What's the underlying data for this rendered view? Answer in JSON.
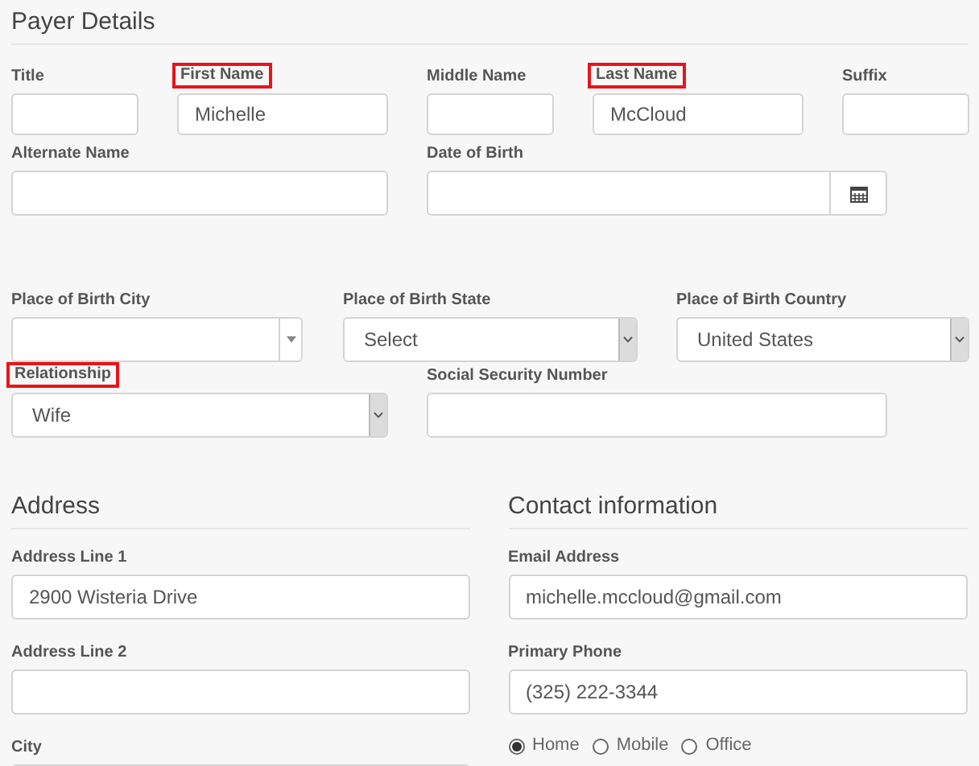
{
  "payer_details": {
    "title": "Payer Details",
    "rows": [
      {
        "fields": [
          {
            "label": "Title",
            "kind": "text",
            "highlighted": false
          },
          {
            "label": "First Name",
            "kind": "text",
            "value": "Michelle",
            "highlighted": true
          },
          {
            "label": "Middle Name",
            "kind": "text",
            "highlighted": false
          },
          {
            "label": "Last Name",
            "kind": "text",
            "value": "McCloud",
            "highlighted": true
          },
          {
            "label": "Suffix",
            "kind": "text",
            "highlighted": false
          }
        ]
      },
      {
        "fields": [
          {
            "label": "Alternate Name",
            "kind": "text",
            "highlighted": false
          },
          {
            "label": "Date of Birth",
            "kind": "date",
            "highlighted": false
          }
        ]
      },
      {
        "fields": [
          {
            "label": "Place of Birth City",
            "kind": "combo",
            "highlighted": false
          },
          {
            "label": "Place of Birth State",
            "kind": "select",
            "value": "Select",
            "highlighted": false
          },
          {
            "label": "Place of Birth Country",
            "kind": "select",
            "value": "United States",
            "highlighted": false
          }
        ]
      },
      {
        "fields": [
          {
            "label": "Relationship",
            "kind": "select",
            "value": "Wife",
            "highlighted": true
          },
          {
            "label": "Social Security Number",
            "kind": "text",
            "highlighted": false
          }
        ]
      }
    ]
  },
  "address": {
    "title": "Address",
    "fields": [
      {
        "label": "Address Line 1",
        "kind": "text",
        "value": "2900 Wisteria Drive"
      },
      {
        "label": "Address Line 2",
        "kind": "text"
      },
      {
        "label": "City",
        "kind": "combo"
      }
    ]
  },
  "contact": {
    "title": "Contact information",
    "fields": [
      {
        "label": "Email Address",
        "kind": "text",
        "value": "michelle.mccloud@gmail.com"
      },
      {
        "label": "Primary Phone",
        "kind": "text",
        "value": "(325) 222-3344"
      }
    ],
    "phone_types": [
      {
        "label": "Home",
        "selected": true
      },
      {
        "label": "Mobile",
        "selected": false
      },
      {
        "label": "Office",
        "selected": false
      }
    ]
  }
}
